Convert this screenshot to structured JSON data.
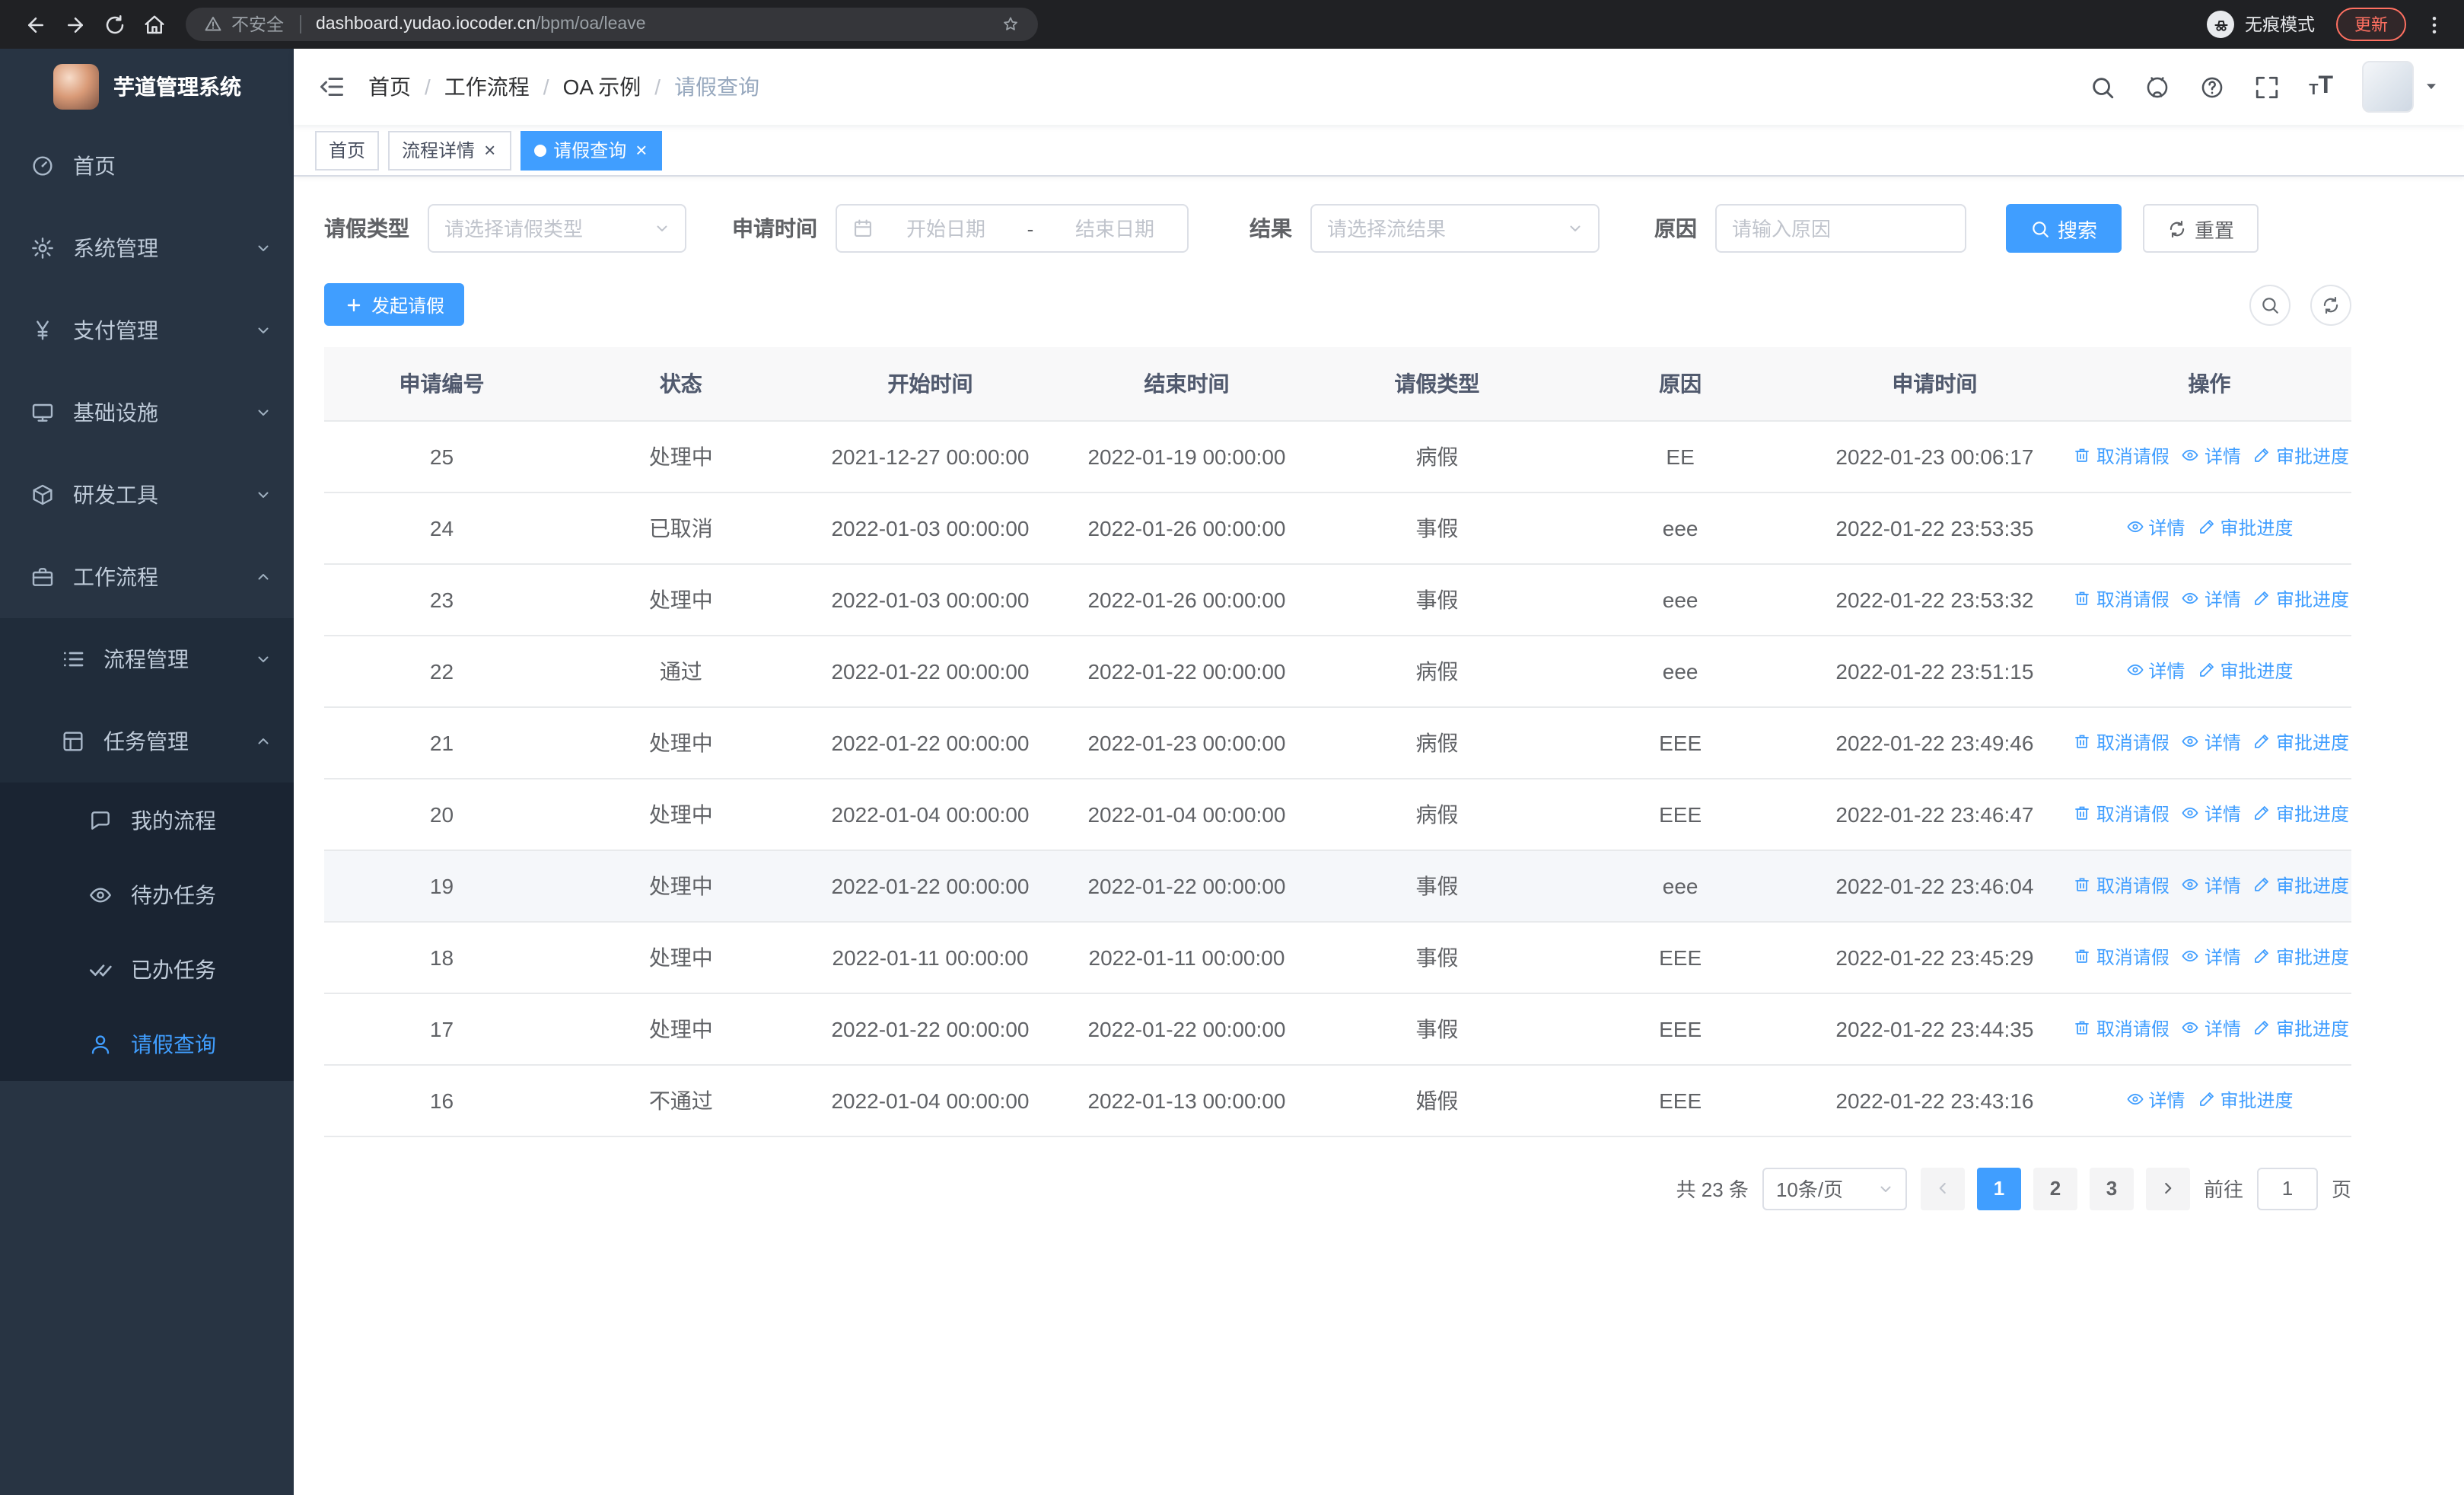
{
  "browser": {
    "security_text": "不安全",
    "url_host": "dashboard.yudao.iocoder.cn",
    "url_path": "/bpm/oa/leave",
    "incognito_label": "无痕模式",
    "update_label": "更新"
  },
  "colors": {
    "primary": "#409eff",
    "sidebar_bg": "#283443",
    "chrome_bg": "#202124"
  },
  "sidebar": {
    "logo_title": "芋道管理系统",
    "menu": [
      {
        "label": "首页",
        "icon": "dashboard-icon",
        "level": 1
      },
      {
        "label": "系统管理",
        "icon": "gear-icon",
        "level": 1,
        "chevron": "down"
      },
      {
        "label": "支付管理",
        "icon": "payment-icon",
        "level": 1,
        "chevron": "down"
      },
      {
        "label": "基础设施",
        "icon": "infrastructure-icon",
        "level": 1,
        "chevron": "down"
      },
      {
        "label": "研发工具",
        "icon": "devtools-icon",
        "level": 1,
        "chevron": "down"
      },
      {
        "label": "工作流程",
        "icon": "workflow-icon",
        "level": 1,
        "chevron": "up",
        "open": true
      },
      {
        "label": "流程管理",
        "icon": "process-icon",
        "level": 2,
        "chevron": "down"
      },
      {
        "label": "任务管理",
        "icon": "task-icon",
        "level": 2,
        "chevron": "up",
        "open": true
      },
      {
        "label": "我的流程",
        "icon": "my-process-icon",
        "level": 3
      },
      {
        "label": "待办任务",
        "icon": "todo-task-icon",
        "level": 3
      },
      {
        "label": "已办任务",
        "icon": "done-task-icon",
        "level": 3
      },
      {
        "label": "请假查询",
        "icon": "leave-query-icon",
        "level": 3,
        "active": true
      }
    ]
  },
  "header": {
    "breadcrumbs": [
      "首页",
      "工作流程",
      "OA 示例",
      "请假查询"
    ]
  },
  "tabs": [
    {
      "label": "首页",
      "closable": false,
      "active": false
    },
    {
      "label": "流程详情",
      "closable": true,
      "active": false
    },
    {
      "label": "请假查询",
      "closable": true,
      "active": true
    }
  ],
  "filters": {
    "leave_type": {
      "label": "请假类型",
      "placeholder": "请选择请假类型"
    },
    "apply_time": {
      "label": "申请时间",
      "start_placeholder": "开始日期",
      "separator": "-",
      "end_placeholder": "结束日期"
    },
    "result": {
      "label": "结果",
      "placeholder": "请选择流结果"
    },
    "reason": {
      "label": "原因",
      "placeholder": "请输入原因"
    },
    "search_button": "搜索",
    "reset_button": "重置"
  },
  "toolbar": {
    "create_button": "发起请假"
  },
  "table": {
    "columns": [
      "申请编号",
      "状态",
      "开始时间",
      "结束时间",
      "请假类型",
      "原因",
      "申请时间",
      "操作"
    ],
    "action_labels": {
      "cancel": "取消请假",
      "detail": "详情",
      "progress": "审批进度"
    },
    "rows": [
      {
        "id": "25",
        "status": "处理中",
        "start_time": "2021-12-27 00:00:00",
        "end_time": "2022-01-19 00:00:00",
        "leave_type": "病假",
        "reason": "EE",
        "apply_time": "2022-01-23 00:06:17",
        "actions": [
          "cancel",
          "detail",
          "progress"
        ]
      },
      {
        "id": "24",
        "status": "已取消",
        "start_time": "2022-01-03 00:00:00",
        "end_time": "2022-01-26 00:00:00",
        "leave_type": "事假",
        "reason": "eee",
        "apply_time": "2022-01-22 23:53:35",
        "actions": [
          "detail",
          "progress"
        ]
      },
      {
        "id": "23",
        "status": "处理中",
        "start_time": "2022-01-03 00:00:00",
        "end_time": "2022-01-26 00:00:00",
        "leave_type": "事假",
        "reason": "eee",
        "apply_time": "2022-01-22 23:53:32",
        "actions": [
          "cancel",
          "detail",
          "progress"
        ]
      },
      {
        "id": "22",
        "status": "通过",
        "start_time": "2022-01-22 00:00:00",
        "end_time": "2022-01-22 00:00:00",
        "leave_type": "病假",
        "reason": "eee",
        "apply_time": "2022-01-22 23:51:15",
        "actions": [
          "detail",
          "progress"
        ]
      },
      {
        "id": "21",
        "status": "处理中",
        "start_time": "2022-01-22 00:00:00",
        "end_time": "2022-01-23 00:00:00",
        "leave_type": "病假",
        "reason": "EEE",
        "apply_time": "2022-01-22 23:49:46",
        "actions": [
          "cancel",
          "detail",
          "progress"
        ]
      },
      {
        "id": "20",
        "status": "处理中",
        "start_time": "2022-01-04 00:00:00",
        "end_time": "2022-01-04 00:00:00",
        "leave_type": "病假",
        "reason": "EEE",
        "apply_time": "2022-01-22 23:46:47",
        "actions": [
          "cancel",
          "detail",
          "progress"
        ]
      },
      {
        "id": "19",
        "status": "处理中",
        "start_time": "2022-01-22 00:00:00",
        "end_time": "2022-01-22 00:00:00",
        "leave_type": "事假",
        "reason": "eee",
        "apply_time": "2022-01-22 23:46:04",
        "actions": [
          "cancel",
          "detail",
          "progress"
        ],
        "hovered": true
      },
      {
        "id": "18",
        "status": "处理中",
        "start_time": "2022-01-11 00:00:00",
        "end_time": "2022-01-11 00:00:00",
        "leave_type": "事假",
        "reason": "EEE",
        "apply_time": "2022-01-22 23:45:29",
        "actions": [
          "cancel",
          "detail",
          "progress"
        ]
      },
      {
        "id": "17",
        "status": "处理中",
        "start_time": "2022-01-22 00:00:00",
        "end_time": "2022-01-22 00:00:00",
        "leave_type": "事假",
        "reason": "EEE",
        "apply_time": "2022-01-22 23:44:35",
        "actions": [
          "cancel",
          "detail",
          "progress"
        ]
      },
      {
        "id": "16",
        "status": "不通过",
        "start_time": "2022-01-04 00:00:00",
        "end_time": "2022-01-13 00:00:00",
        "leave_type": "婚假",
        "reason": "EEE",
        "apply_time": "2022-01-22 23:43:16",
        "actions": [
          "detail",
          "progress"
        ]
      }
    ]
  },
  "pagination": {
    "total_text": "共 23 条",
    "page_size_label": "10条/页",
    "pages": [
      "1",
      "2",
      "3"
    ],
    "active_page": "1",
    "goto_prefix": "前往",
    "goto_value": "1",
    "goto_suffix": "页"
  }
}
